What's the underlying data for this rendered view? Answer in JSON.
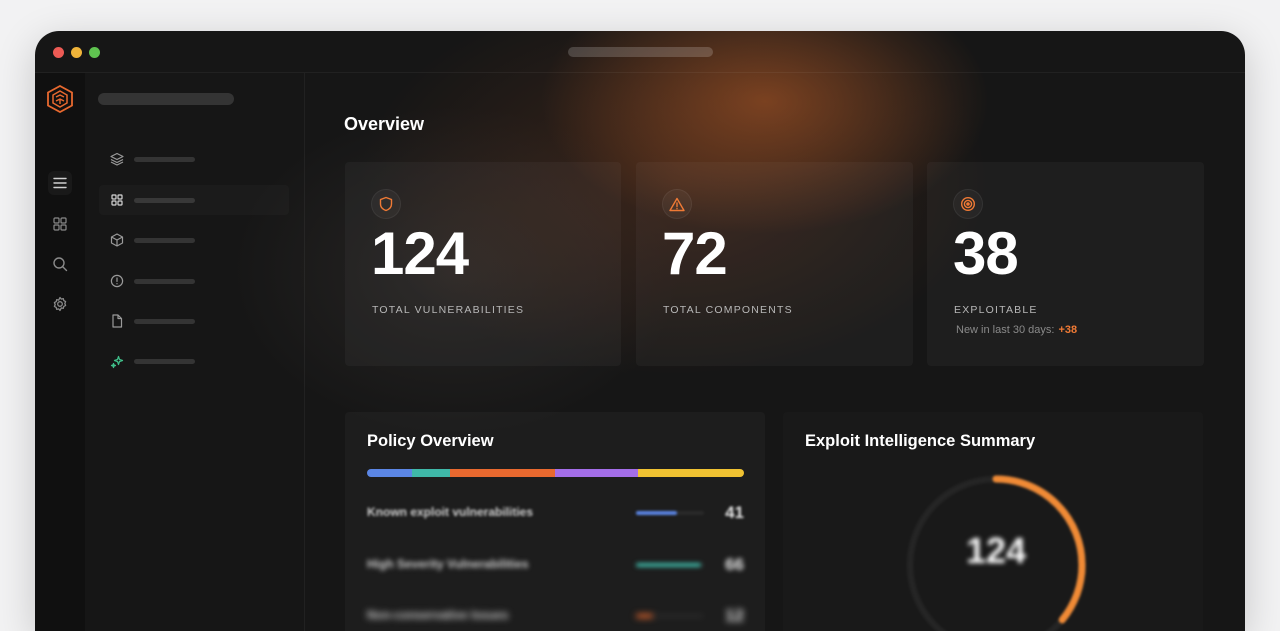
{
  "page": {
    "title": "Overview"
  },
  "stats": [
    {
      "icon": "shield-icon",
      "value": "124",
      "label": "TOTAL VULNERABILITIES"
    },
    {
      "icon": "warning-triangle-icon",
      "value": "72",
      "label": "TOTAL COMPONENTS"
    },
    {
      "icon": "target-icon",
      "value": "38",
      "label": "EXPLOITABLE",
      "sub_label": "New in last 30 days:",
      "sub_delta": "+38"
    }
  ],
  "policy": {
    "title": "Policy Overview",
    "segments": [
      {
        "color": "#5b86e5",
        "fraction": 0.12
      },
      {
        "color": "#3fb8a8",
        "fraction": 0.1
      },
      {
        "color": "#e8692f",
        "fraction": 0.28
      },
      {
        "color": "#a46ee8",
        "fraction": 0.22
      },
      {
        "color": "#f0c232",
        "fraction": 0.28
      }
    ],
    "rows": [
      {
        "label": "Known exploit vulnerabilities",
        "count": "41",
        "fill_color": "#5b86e5",
        "fill": 0.6
      },
      {
        "label": "High Severity Vulnerabilities",
        "count": "66",
        "fill_color": "#3fb8a8",
        "fill": 0.95
      },
      {
        "label": "Non-conservative Issues",
        "count": "12",
        "fill_color": "#e8692f",
        "fill": 0.25
      }
    ]
  },
  "exploit": {
    "title": "Exploit Intelligence Summary",
    "total": "124",
    "arc_fraction": 0.36,
    "arc_color": "#f08a35"
  },
  "sidebar": {
    "items": [
      {
        "icon": "layers-icon"
      },
      {
        "icon": "grid-icon"
      },
      {
        "icon": "cube-icon"
      },
      {
        "icon": "alert-circle-icon"
      },
      {
        "icon": "file-icon"
      },
      {
        "icon": "sparkle-icon"
      }
    ]
  },
  "rail": {
    "icons": [
      "menu-icon",
      "grid-icon",
      "search-icon",
      "gear-icon"
    ]
  },
  "colors": {
    "accent": "#f07a35",
    "background": "#161616"
  }
}
